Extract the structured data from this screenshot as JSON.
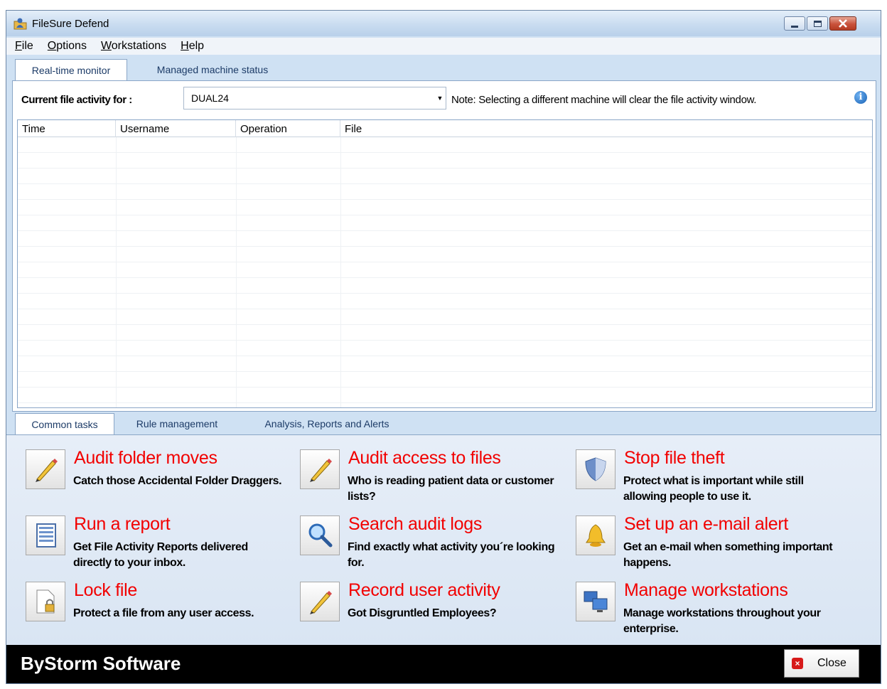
{
  "window": {
    "title": "FileSure Defend"
  },
  "menu": [
    {
      "underline": "F",
      "rest": "ile"
    },
    {
      "underline": "O",
      "rest": "ptions"
    },
    {
      "underline": "W",
      "rest": "orkstations"
    },
    {
      "underline": "H",
      "rest": "elp"
    }
  ],
  "top_tabs": [
    "Real-time monitor",
    "Managed machine status"
  ],
  "monitor": {
    "current_label": "Current file activity for :",
    "machine": "DUAL24",
    "note": "Note: Selecting a different machine will clear the file activity window.",
    "columns": [
      "Time",
      "Username",
      "Operation",
      "File"
    ]
  },
  "bottom_tabs": [
    "Common tasks",
    "Rule management",
    "Analysis, Reports and Alerts"
  ],
  "tasks": [
    {
      "title": "Audit folder moves",
      "desc": "Catch those Accidental Folder Draggers.",
      "icon": "pencil-icon"
    },
    {
      "title": "Audit access to files",
      "desc": "Who is reading patient data or customer lists?",
      "icon": "pencil-icon"
    },
    {
      "title": "Stop file theft",
      "desc": "Protect what is important while still allowing people to use it.",
      "icon": "shield-icon"
    },
    {
      "title": "Run a report",
      "desc": "Get File Activity Reports delivered directly to your inbox.",
      "icon": "report-icon"
    },
    {
      "title": "Search audit logs",
      "desc": "Find exactly what activity you´re looking for.",
      "icon": "magnifier-icon"
    },
    {
      "title": "Set up an e-mail alert",
      "desc": "Get an e-mail when something important happens.",
      "icon": "bell-icon"
    },
    {
      "title": "Lock file",
      "desc": "Protect a file from any user access.",
      "icon": "lock-file-icon"
    },
    {
      "title": "Record user activity",
      "desc": "Got Disgruntled Employees?",
      "icon": "pencil-icon"
    },
    {
      "title": "Manage workstations",
      "desc": "Manage workstations throughout your enterprise.",
      "icon": "computers-icon"
    }
  ],
  "footer": {
    "brand": "ByStorm Software",
    "close_label": "Close"
  }
}
